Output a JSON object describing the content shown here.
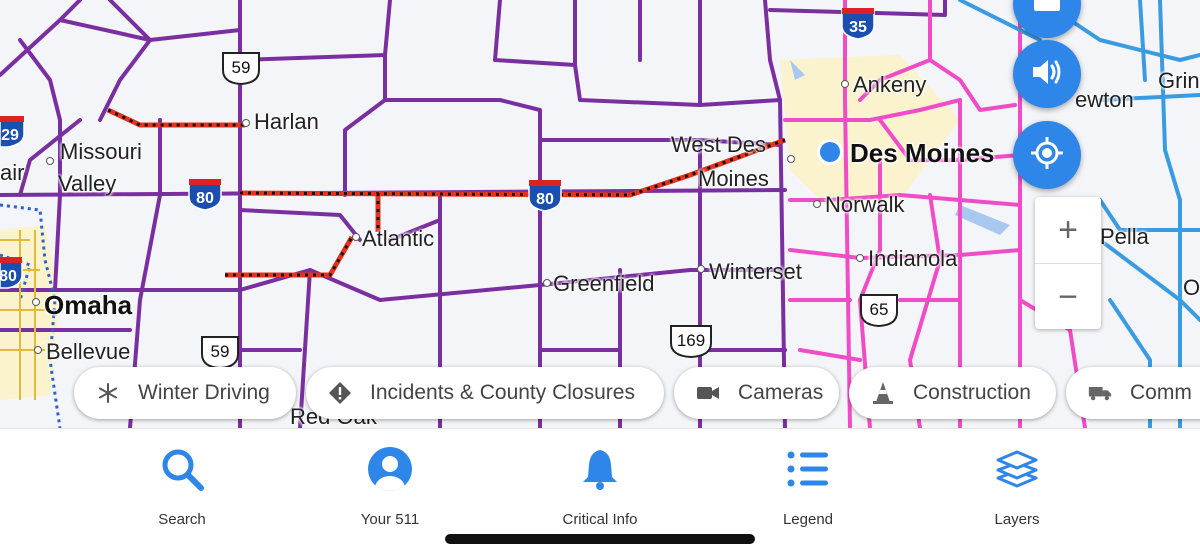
{
  "map": {
    "cities": {
      "harlan": "Harlan",
      "missouri": "Missouri",
      "valley": "Valley",
      "atlantic": "Atlantic",
      "omaha": "Omaha",
      "bellevue": "Bellevue",
      "greenfield": "Greenfield",
      "winterset": "Winterset",
      "west_des": "West Des",
      "moines_w": "Moines",
      "des_moines": "Des Moines",
      "ankeny": "Ankeny",
      "norwalk": "Norwalk",
      "indianola": "Indianola",
      "newton": "ewton",
      "pella": "Pella",
      "grinnell": "Grin",
      "red_oak": "Red Oak",
      "edge_air": "air",
      "edge_o": "O"
    },
    "shields": {
      "us59_top": "59",
      "us59_bottom": "59",
      "i80_west": "80",
      "i80_east": "80",
      "i35": "35",
      "us65": "65",
      "us169": "169",
      "i29": "29",
      "i80_edge": "80"
    },
    "colors": {
      "road_purple": "#7a2fa0",
      "road_pink": "#f04cc8",
      "road_blue": "#3a9be0",
      "closure_red": "#e8311a",
      "urban_yellow": "#fbf3c2",
      "button_blue": "#2e86e8"
    }
  },
  "controls": {
    "top_button_icon": "card-icon",
    "sound_icon": "speaker-icon",
    "locate_icon": "crosshair-icon",
    "zoom_in": "+",
    "zoom_out": "−"
  },
  "filters": [
    {
      "label": "Winter Driving",
      "icon": "snowflake-icon"
    },
    {
      "label": "Incidents & County Closures",
      "icon": "warning-icon"
    },
    {
      "label": "Cameras",
      "icon": "camera-icon"
    },
    {
      "label": "Construction",
      "icon": "cone-icon"
    },
    {
      "label": "Comm",
      "icon": "truck-icon"
    }
  ],
  "tabs": [
    {
      "label": "Search",
      "icon": "search-icon"
    },
    {
      "label": "Your 511",
      "icon": "user-icon"
    },
    {
      "label": "Critical Info",
      "icon": "bell-icon"
    },
    {
      "label": "Legend",
      "icon": "list-icon"
    },
    {
      "label": "Layers",
      "icon": "layers-icon"
    }
  ]
}
